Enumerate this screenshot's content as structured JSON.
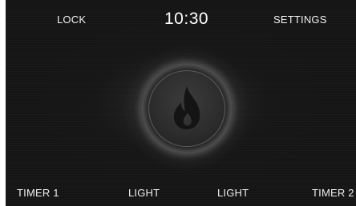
{
  "header": {
    "lock_label": "LOCK",
    "time": "10:30",
    "settings_label": "SETTINGS"
  },
  "footer": {
    "timer1_label": "TIMER 1",
    "light1_label": "LIGHT",
    "light2_label": "LIGHT",
    "timer2_label": "TIMER 2"
  },
  "center": {
    "icon": "flame-icon"
  },
  "colors": {
    "screen_background": "#151515",
    "text": "#f0f0f0",
    "button_face": "#2c2c2c",
    "flame": "#141414"
  }
}
